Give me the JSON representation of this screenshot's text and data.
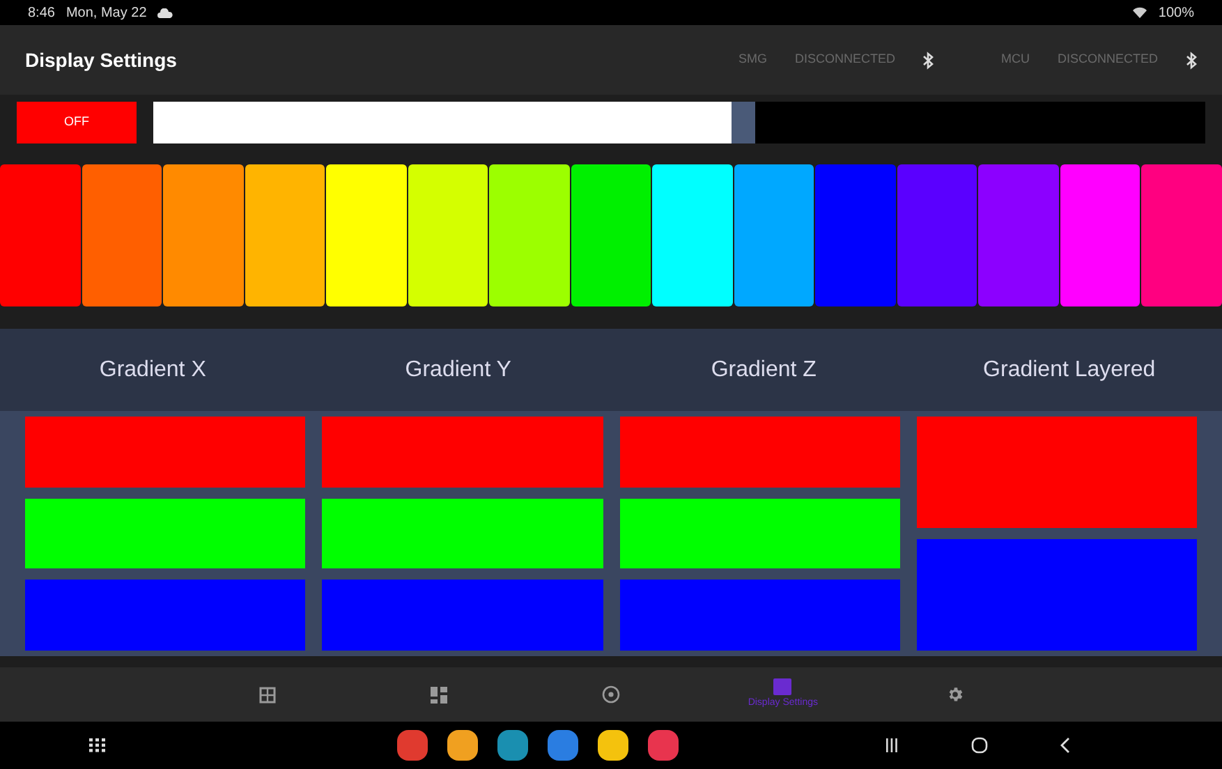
{
  "status_bar": {
    "time": "8:46",
    "date": "Mon, May 22",
    "battery": "100%"
  },
  "app_bar": {
    "title": "Display Settings",
    "connections": [
      {
        "name": "SMG",
        "status": "DISCONNECTED"
      },
      {
        "name": "MCU",
        "status": "DISCONNECTED"
      }
    ]
  },
  "power_button": {
    "label": "OFF"
  },
  "brightness": {
    "level": 0.55
  },
  "swatches": [
    {
      "color": "#ff0000"
    },
    {
      "color": "#ff5f00"
    },
    {
      "color": "#ff8a00"
    },
    {
      "color": "#ffb400"
    },
    {
      "color": "#ffff00"
    },
    {
      "color": "#d4ff00"
    },
    {
      "color": "#9cff00"
    },
    {
      "color": "#00f000"
    },
    {
      "color": "#00ffff"
    },
    {
      "color": "#00a8ff"
    },
    {
      "color": "#0000ff"
    },
    {
      "color": "#5a00ff"
    },
    {
      "color": "#8c00ff"
    },
    {
      "color": "#ff00ff"
    },
    {
      "color": "#ff0080"
    }
  ],
  "gradients": [
    {
      "title": "Gradient X",
      "layers": [
        {
          "color": "#ff0000"
        },
        {
          "color": "#00ff00"
        },
        {
          "color": "#0000ff"
        }
      ]
    },
    {
      "title": "Gradient Y",
      "layers": [
        {
          "color": "#ff0000"
        },
        {
          "color": "#00ff00"
        },
        {
          "color": "#0000ff"
        }
      ]
    },
    {
      "title": "Gradient Z",
      "layers": [
        {
          "color": "#ff0000"
        },
        {
          "color": "#00ff00"
        },
        {
          "color": "#0000ff"
        }
      ]
    },
    {
      "title": "Gradient Layered",
      "layers": [
        {
          "color": "#ff0000"
        },
        {
          "color": "#0000ff"
        }
      ]
    }
  ],
  "bottom_nav": [
    {
      "kind": "table",
      "selected": false
    },
    {
      "kind": "dashboard",
      "selected": false
    },
    {
      "kind": "target",
      "selected": false
    },
    {
      "kind": "display",
      "selected": true,
      "label": "Display Settings"
    },
    {
      "kind": "gear",
      "selected": false
    }
  ],
  "dock": [
    {
      "color": "#e03a2f"
    },
    {
      "color": "#f0a020"
    },
    {
      "color": "#1a8fb0"
    },
    {
      "color": "#2a7de1"
    },
    {
      "color": "#f4c20d"
    },
    {
      "color": "#e8344e"
    }
  ]
}
